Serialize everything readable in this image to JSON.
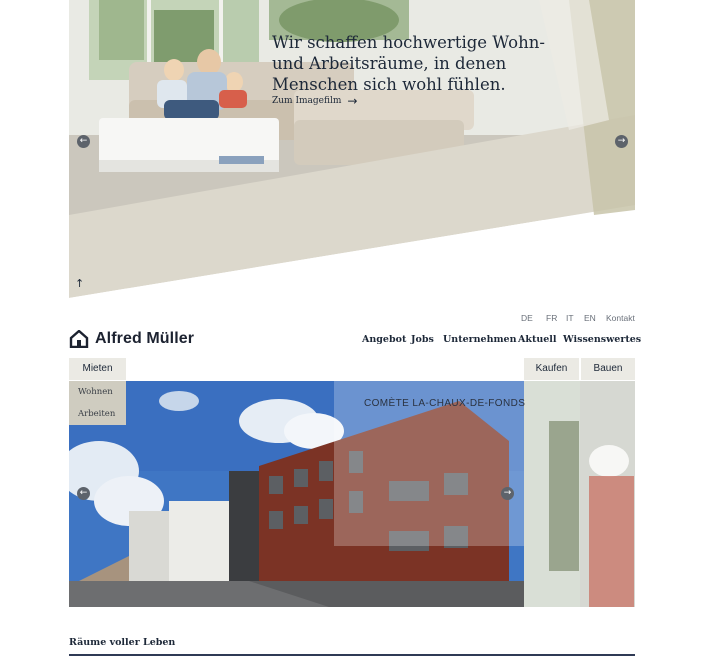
{
  "hero": {
    "quote_line1": "Wir schaffen hochwertige Wohn-",
    "quote_line2": "und Arbeitsräume, in denen",
    "quote_line3": "Menschen sich wohl fühlen.",
    "link_label": "Zum Imagefilm",
    "prev_icon": "arrow-left-icon",
    "next_icon": "arrow-right-icon",
    "up_icon": "arrow-up-icon"
  },
  "languages": [
    "DE",
    "FR",
    "IT",
    "EN"
  ],
  "contact_label": "Kontakt",
  "brand": {
    "name": "Alfred Müller",
    "logo_icon": "house-icon"
  },
  "nav": [
    "Angebot",
    "Jobs",
    "Unternehmen",
    "Aktuell",
    "Wissenswertes"
  ],
  "tabs": {
    "mieten": "Mieten",
    "kaufen": "Kaufen",
    "bauen": "Bauen"
  },
  "subtabs": [
    "Wohnen",
    "Arbeiten"
  ],
  "project": {
    "label": "COMÈTE LA-CHAUX-DE-FONDS"
  },
  "section": {
    "title": "Räume voller Leben"
  },
  "colors": {
    "accent_beige": "#dcd8cc",
    "navy": "#1d2838",
    "olive": "#b6b08f"
  }
}
